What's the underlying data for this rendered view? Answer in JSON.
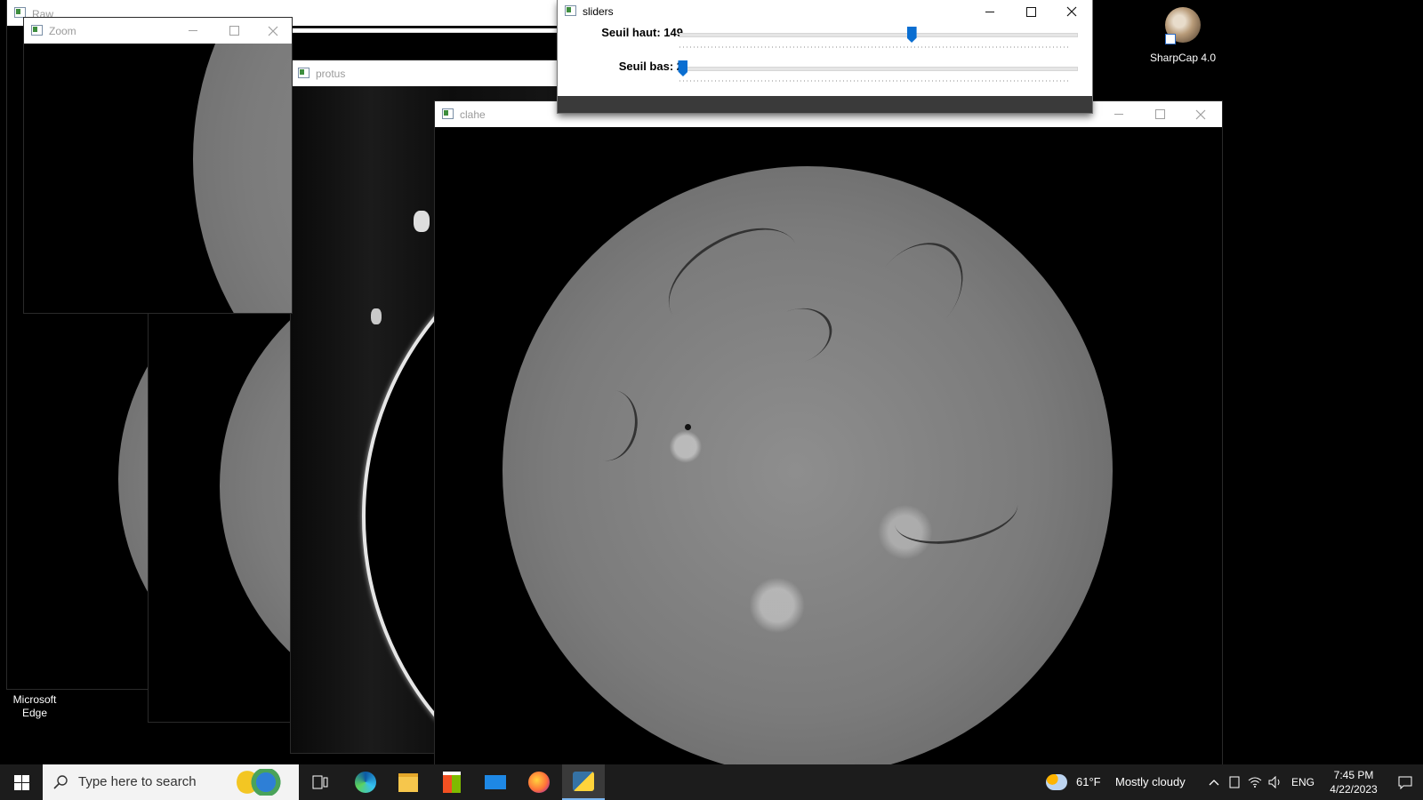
{
  "windows": {
    "raw": {
      "title": "Raw"
    },
    "zoom": {
      "title": "Zoom"
    },
    "protus": {
      "title": "protus"
    },
    "sliders": {
      "title": "sliders",
      "seuil_haut_label": "Seuil haut: 149",
      "seuil_haut_value": 149,
      "seuil_bas_label": "Seuil bas: 2",
      "seuil_bas_value": 2
    },
    "clahe": {
      "title": "clahe"
    }
  },
  "desktop": {
    "sharpcap_label": "SharpCap 4.0",
    "edge_label_line1": "Microsoft",
    "edge_label_line2": "Edge"
  },
  "taskbar": {
    "search_placeholder": "Type here to search",
    "weather_temp": "61°F",
    "weather_desc": "Mostly cloudy",
    "language": "ENG",
    "time": "7:45 PM",
    "date": "4/22/2023",
    "pinned_icons": [
      "task-view-icon",
      "edge-icon",
      "file-explorer-icon",
      "store-icon",
      "mail-icon",
      "firefox-icon",
      "python-app-icon"
    ]
  },
  "colors": {
    "accent": "#0a6ed1",
    "taskbar_bg": "#1c1c1c",
    "desktop_bg": "#000000"
  }
}
